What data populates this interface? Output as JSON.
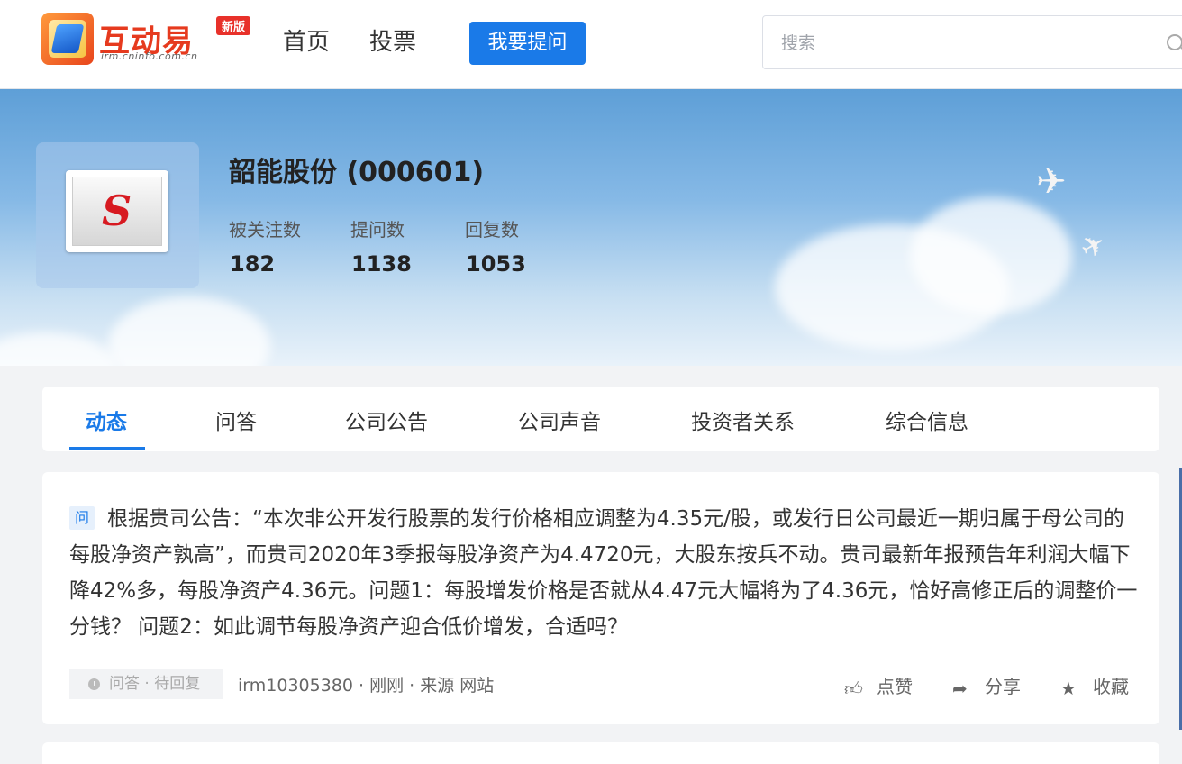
{
  "header": {
    "logo_text": "互动易",
    "logo_sub": "irm.cninfo.com.cn",
    "logo_badge": "新版",
    "nav": {
      "home": "首页",
      "vote": "投票"
    },
    "ask_button": "我要提问",
    "search_placeholder": "搜索"
  },
  "company": {
    "name": "韶能股份 (000601)",
    "stats": [
      {
        "label": "被关注数",
        "value": "182"
      },
      {
        "label": "提问数",
        "value": "1138"
      },
      {
        "label": "回复数",
        "value": "1053"
      }
    ]
  },
  "tabs": [
    "动态",
    "问答",
    "公司公告",
    "公司声音",
    "投资者关系",
    "综合信息"
  ],
  "post": {
    "badge": "问",
    "text": "根据贵司公告：“本次非公开发行股票的发行价格相应调整为4.35元/股，或发行日公司最近一期归属于母公司的每股净资产孰高”，而贵司2020年3季报每股净资产为4.4720元，大股东按兵不动。贵司最新年报预告年利润大幅下降42%多，每股净资产4.36元。问题1：每股增发价格是否就从4.47元大幅将为了4.36元，恰好高修正后的调整价一分钱？ 问题2：如此调节每股净资产迎合低价增发，合适吗？",
    "status": "问答 · 待回复",
    "meta": "irm10305380 · 刚刚 · 来源 网站",
    "actions": {
      "like": "点赞",
      "share": "分享",
      "favorite": "收藏"
    }
  }
}
